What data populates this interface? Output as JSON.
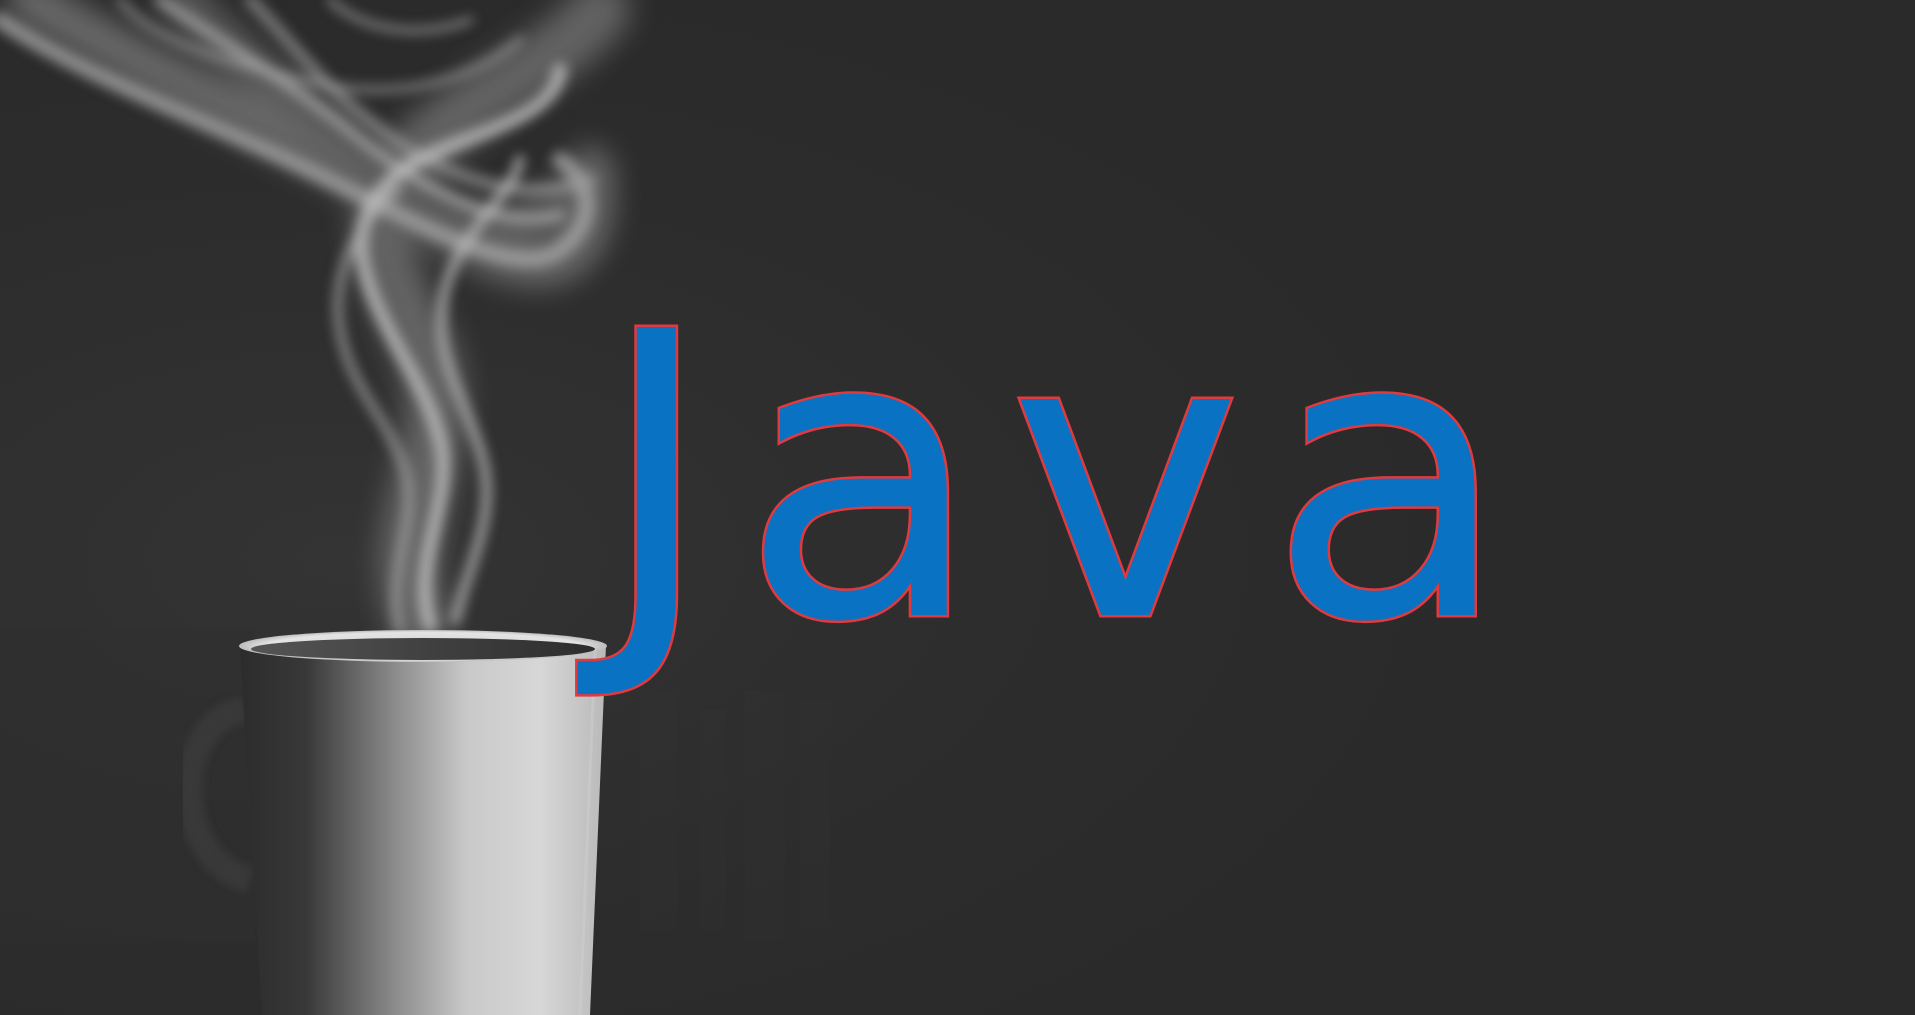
{
  "title": {
    "text": "Java"
  },
  "colors": {
    "background": "#2a2a2a",
    "title_fill": "#0a72c2",
    "title_outline": "#e03a3f"
  },
  "image": {
    "subject": "steaming-coffee-cup",
    "tone": "grayscale"
  }
}
